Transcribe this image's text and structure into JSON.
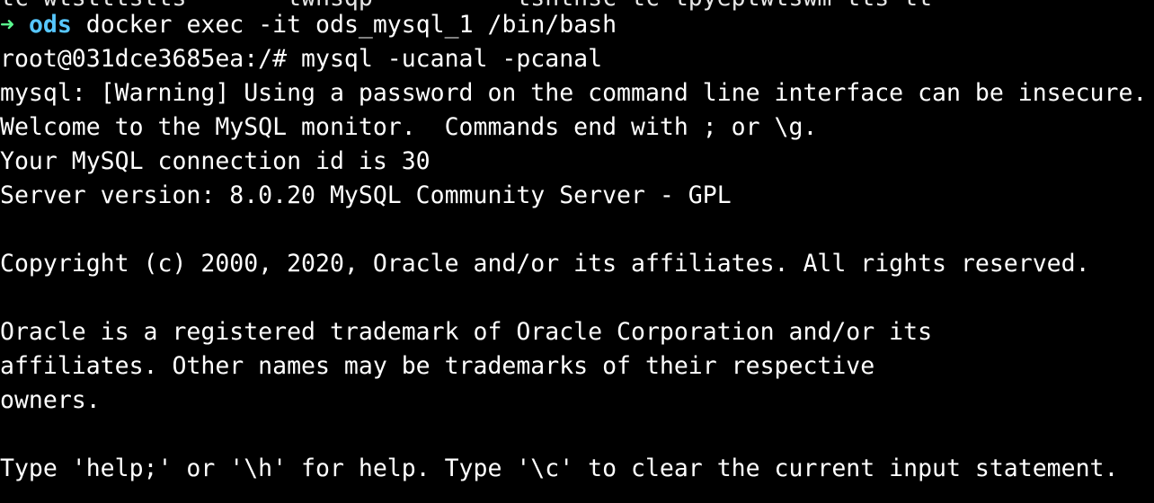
{
  "terminal": {
    "partial_top_line": "tc-wtstttstts-  --  twhsqp-  -----  tshthsc-tc-tpyeptwtswm-tts-tt-",
    "prompt": {
      "arrow_icon": "➜",
      "dir": "ods",
      "command": " docker exec -it ods_mysql_1 /bin/bash"
    },
    "lines": [
      "root@031dce3685ea:/# mysql -ucanal -pcanal",
      "mysql: [Warning] Using a password on the command line interface can be insecure.",
      "Welcome to the MySQL monitor.  Commands end with ; or \\g.",
      "Your MySQL connection id is 30",
      "Server version: 8.0.20 MySQL Community Server - GPL",
      "Copyright (c) 2000, 2020, Oracle and/or its affiliates. All rights reserved.",
      "Oracle is a registered trademark of Oracle Corporation and/or its",
      "affiliates. Other names may be trademarks of their respective",
      "owners.",
      "Type 'help;' or '\\h' for help. Type '\\c' to clear the current input statement."
    ]
  },
  "colors": {
    "background": "#000000",
    "text": "#ffffff",
    "arrow": "#5af78e",
    "directory": "#57c7ff"
  }
}
